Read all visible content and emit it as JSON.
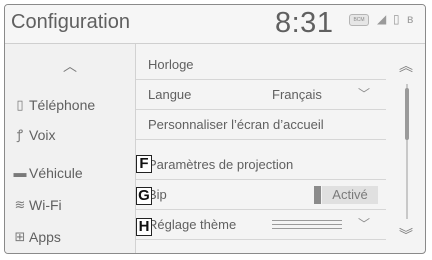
{
  "header": {
    "title": "Configuration",
    "time": "8:31",
    "status_badge": "BCM"
  },
  "sidebar": {
    "items": [
      {
        "label": "Téléphone",
        "icon": "phone-icon"
      },
      {
        "label": "Voix",
        "icon": "voice-icon"
      },
      {
        "label": "Véhicule",
        "icon": "car-icon"
      },
      {
        "label": "Wi-Fi",
        "icon": "wifi-icon"
      },
      {
        "label": "Apps",
        "icon": "apps-icon"
      }
    ]
  },
  "settings": {
    "horloge": "Horloge",
    "langue": "Langue",
    "langue_value": "Français",
    "personnaliser": "Personnaliser l’écran d’accueil",
    "projection": "Paramètres de projection",
    "bip": "Bip",
    "bip_value": "Activé",
    "theme": "Réglage thème"
  },
  "callouts": {
    "f": "F",
    "g": "G",
    "h": "H"
  }
}
